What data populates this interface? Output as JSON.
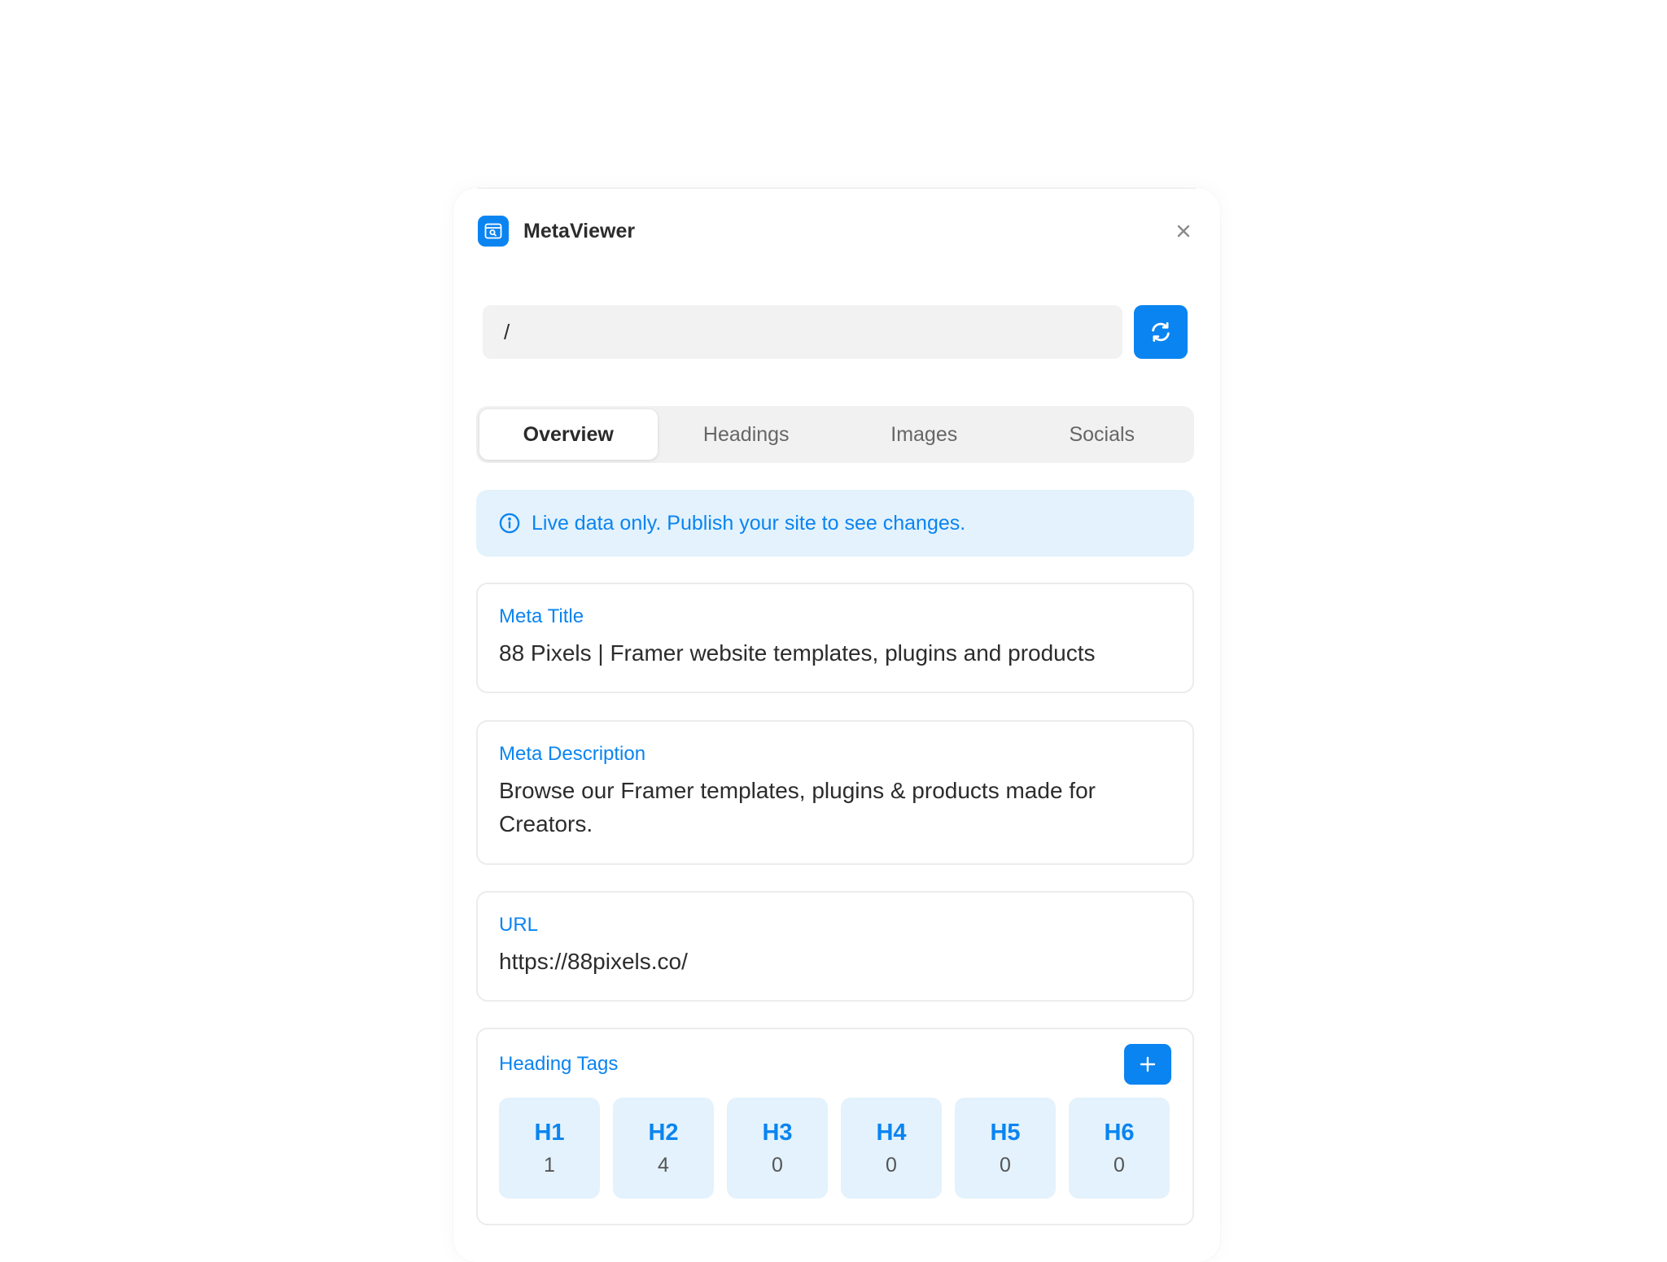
{
  "app": {
    "title": "MetaViewer",
    "icon": "browser-search-icon",
    "accent_color": "#0a84f1"
  },
  "path_input": {
    "value": "/"
  },
  "tabs": [
    {
      "label": "Overview",
      "active": true
    },
    {
      "label": "Headings",
      "active": false
    },
    {
      "label": "Images",
      "active": false
    },
    {
      "label": "Socials",
      "active": false
    }
  ],
  "notice": {
    "text": "Live data only. Publish your site to see changes."
  },
  "meta_title": {
    "label": "Meta Title",
    "value": "88 Pixels | Framer website templates, plugins and products"
  },
  "meta_description": {
    "label": "Meta Description",
    "value": "Browse our Framer templates, plugins & products made for Creators."
  },
  "url": {
    "label": "URL",
    "value": "https://88pixels.co/"
  },
  "heading_tags": {
    "label": "Heading Tags",
    "items": [
      {
        "name": "H1",
        "count": "1"
      },
      {
        "name": "H2",
        "count": "4"
      },
      {
        "name": "H3",
        "count": "0"
      },
      {
        "name": "H4",
        "count": "0"
      },
      {
        "name": "H5",
        "count": "0"
      },
      {
        "name": "H6",
        "count": "0"
      }
    ]
  }
}
